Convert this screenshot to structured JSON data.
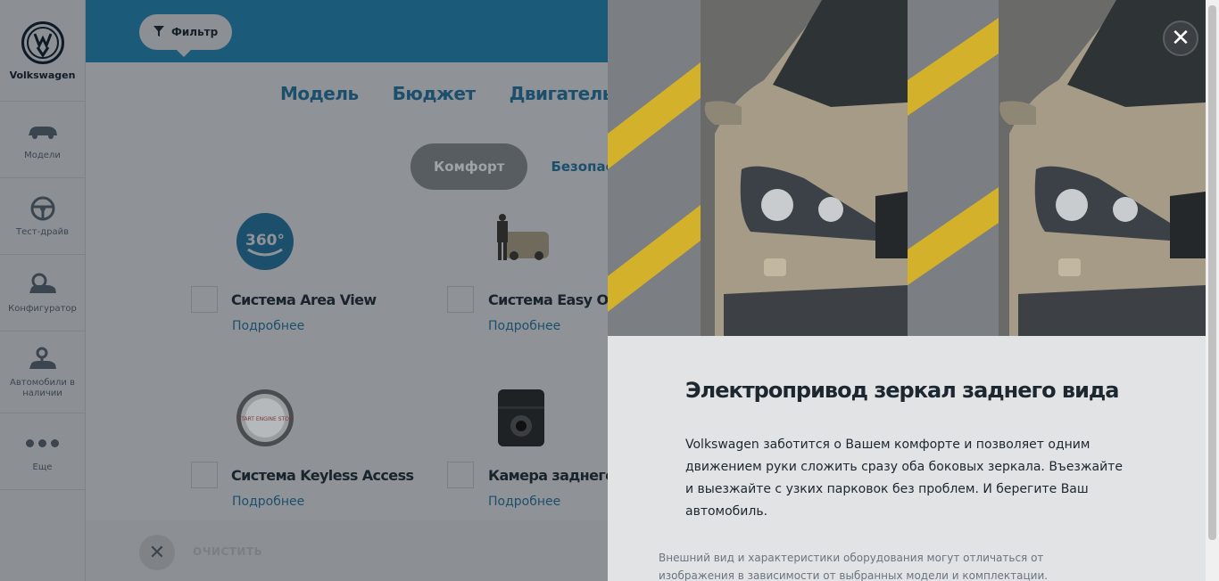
{
  "sidebar": {
    "brand": "Volkswagen",
    "items": [
      {
        "label": "Модели",
        "icon": "car-icon"
      },
      {
        "label": "Тест-драйв",
        "icon": "steering-wheel-icon"
      },
      {
        "label": "Конфигуратор",
        "icon": "car-settings-icon"
      },
      {
        "label": "Автомобили в наличии",
        "icon": "car-key-icon"
      },
      {
        "label": "Еще",
        "icon": "more-dots-icon"
      }
    ]
  },
  "filter": {
    "label": "Фильтр"
  },
  "tabs": [
    "Модель",
    "Бюджет",
    "Двигатель"
  ],
  "chips": {
    "active": "Комфорт",
    "next": "Безопасность"
  },
  "features": [
    {
      "title": "Система Area View",
      "more": "Подробнее",
      "icon_text": "360°"
    },
    {
      "title": "Система Easy Open",
      "more": "Подробнее"
    },
    {
      "title": "Система Keyless Access",
      "more": "Подробнее",
      "icon_text": "START ENGINE STOP"
    },
    {
      "title": "Камера заднего вида",
      "more": "Подробнее"
    }
  ],
  "clear": {
    "label": "ОЧИСТИТЬ"
  },
  "modal": {
    "title": "Электропривод зеркал заднего вида",
    "description": "Volkswagen заботится о Вашем комфорте и позволяет одним движением руки сложить сразу оба боковых зеркала. Въезжайте и выезжайте с узких парковок без проблем. И берегите Ваш автомобиль.",
    "note": "Внешний вид и характеристики оборудования могут отличаться от изображения в зависимости от выбранных модели и комплектации."
  },
  "colors": {
    "accent": "#1c4f6c",
    "overlay": "#8f9397",
    "modal_bg": "#e1e3e5",
    "stripe": "#d4b12a"
  }
}
